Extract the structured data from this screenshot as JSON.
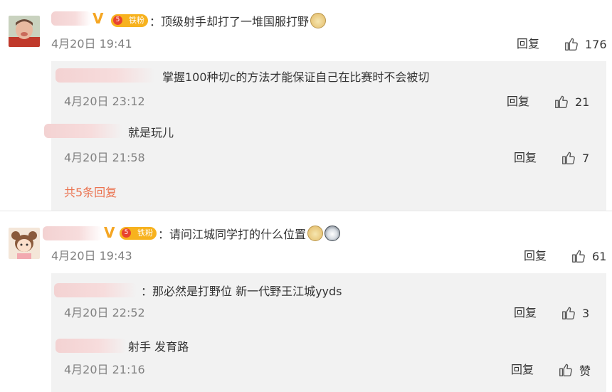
{
  "comments": [
    {
      "text": "：顶级射手却打了一堆国服打野",
      "time": "4月20日 19:41",
      "reply_label": "回复",
      "likes": "176",
      "fan_badge": "铁粉",
      "fan_level": "5",
      "replies": [
        {
          "text": "掌握100种切c的方法才能保证自己在比赛时不会被切",
          "time": "4月20日 23:12",
          "reply_label": "回复",
          "likes": "21"
        },
        {
          "text": "就是玩儿",
          "time": "4月20日 21:58",
          "reply_label": "回复",
          "likes": "7"
        }
      ],
      "more_replies": "共5条回复"
    },
    {
      "text": "：请问江城同学打的什么位置",
      "time": "4月20日 19:43",
      "reply_label": "回复",
      "likes": "61",
      "fan_badge": "铁粉",
      "fan_level": "5",
      "replies": [
        {
          "text": "：那必然是打野位 新一代野王江城yyds",
          "time": "4月20日 22:52",
          "reply_label": "回复",
          "likes": "3"
        },
        {
          "text": "射手 发育路",
          "time": "4月20日 21:16",
          "reply_label": "回复",
          "likes": "赞"
        }
      ]
    }
  ],
  "colors": {
    "link": "#eb7350",
    "reply_bg": "#f2f2f2",
    "vip": "#f5a623",
    "fan_badge": "#f7b21e"
  },
  "icons": {
    "like": "thumbs-up-icon",
    "verified": "v-badge-icon",
    "fan": "fan-badge-icon",
    "emoji1": "doge-emoji-icon",
    "emoji2": "husky-emoji-icon"
  }
}
